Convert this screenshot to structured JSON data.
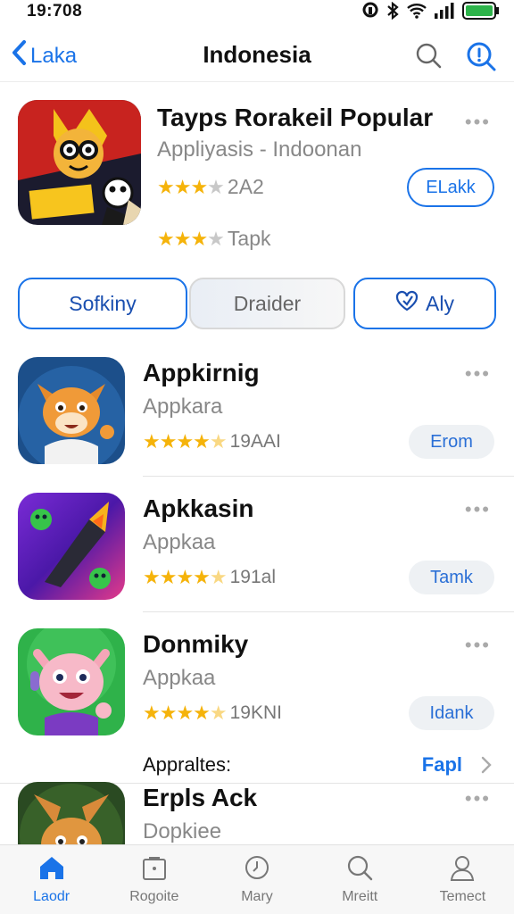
{
  "status": {
    "time": "19:708"
  },
  "nav": {
    "back_label": "Laka",
    "title": "Indonesia"
  },
  "featured": {
    "title": "Tayps Rorakeil Popular",
    "subtitle": "Appliyasis - Indoonan",
    "rating_text": "2A2",
    "rating2_text": "Tapk",
    "more": "•••",
    "get_label": "ELakk",
    "rating_value": 3.5
  },
  "segments": {
    "seg1": "Sofkiny",
    "seg2": "Draider",
    "seg3": "Aly"
  },
  "apps": [
    {
      "name": "Appkirnig",
      "subtitle": "Appkara",
      "rating_text": "19AAI",
      "get_label": "Erom",
      "more": "•••",
      "rating_value": 4.5
    },
    {
      "name": "Apkkasin",
      "subtitle": "Appkaa",
      "rating_text": "191al",
      "get_label": "Tamk",
      "more": "•••",
      "rating_value": 4.5
    },
    {
      "name": "Donmiky",
      "subtitle": "Appkaa",
      "rating_text": "19KNI",
      "get_label": "Idank",
      "more": "•••",
      "rating_value": 4.5
    }
  ],
  "see_all": {
    "label": "Appraltes:",
    "link": "Fapl"
  },
  "last_app": {
    "name": "Erpls Ack",
    "subtitle": "Dopkiee",
    "more": "•••"
  },
  "tabs": [
    {
      "label": "Laodr",
      "icon": "home-icon"
    },
    {
      "label": "Rogoite",
      "icon": "bag-icon"
    },
    {
      "label": "Mary",
      "icon": "clock-icon"
    },
    {
      "label": "Mreitt",
      "icon": "search-icon"
    },
    {
      "label": "Temect",
      "icon": "profile-icon"
    }
  ],
  "colors": {
    "accent": "#1a73e8",
    "star": "#f5b30a",
    "muted": "#888888"
  }
}
